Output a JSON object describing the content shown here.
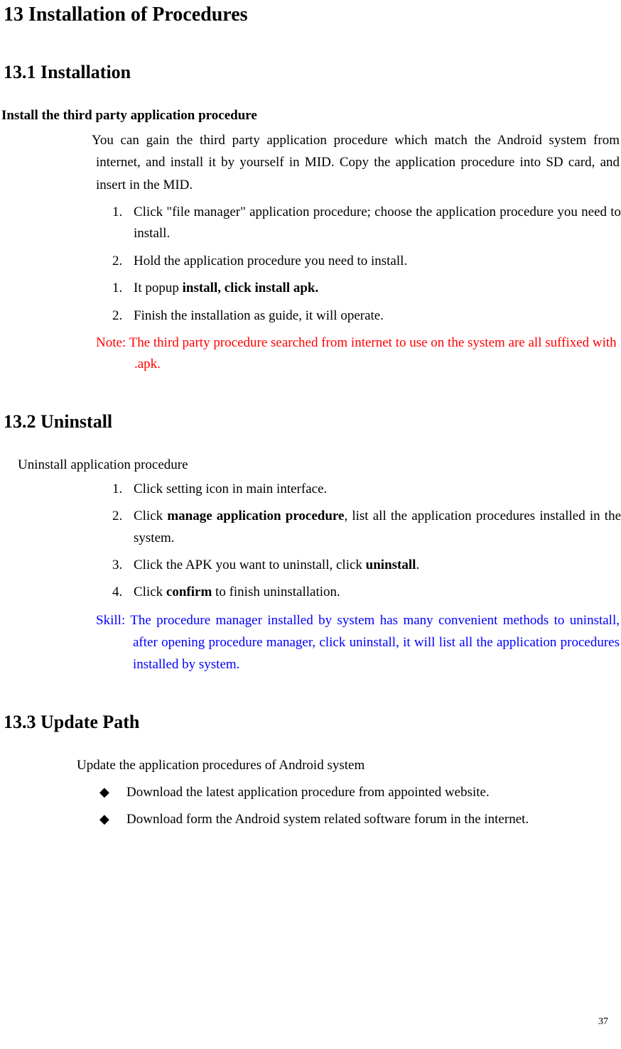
{
  "page_title": "13 Installation of Procedures",
  "page_number": "37",
  "section1": {
    "heading": "13.1 Installation",
    "subtitle": "Install the third party application procedure",
    "intro": "You can gain the third party application procedure which match the Android system from internet, and install it by yourself in MID. Copy the application procedure into SD card, and insert in the MID.",
    "steps": [
      {
        "n": "1.",
        "text_before": "Click \"file manager\" application procedure; choose the application procedure you need to install."
      },
      {
        "n": "2.",
        "text_before": "Hold the application procedure you need to install."
      },
      {
        "n": "1.",
        "text_before": "It popup ",
        "bold": "install, click install apk."
      },
      {
        "n": "2.",
        "text_before": "Finish the installation as guide, it will operate."
      }
    ],
    "note": "Note: The third party procedure searched from internet to use on the system are all suffixed with .apk."
  },
  "section2": {
    "heading": "13.2 Uninstall",
    "intro": "Uninstall application procedure",
    "steps": [
      {
        "n": "1.",
        "text_before": "Click setting icon in main interface."
      },
      {
        "n": "2.",
        "text_before": "Click ",
        "bold": "manage application procedure",
        "text_after": ", list all the application procedures installed in the system."
      },
      {
        "n": "3.",
        "text_before": "Click the APK you want to uninstall, click ",
        "bold": "uninstall",
        "text_after": "."
      },
      {
        "n": "4.",
        "text_before": "Click ",
        "bold": "confirm",
        "text_after": " to finish uninstallation."
      }
    ],
    "skill": "Skill: The procedure manager installed by system has many convenient methods to uninstall, after opening procedure manager, click uninstall, it will list all the application procedures installed by system."
  },
  "section3": {
    "heading": "13.3 Update Path",
    "intro": "Update the application procedures of Android system",
    "bullets": [
      "Download the latest application procedure from appointed website.",
      "Download form the Android system related software forum in the internet."
    ]
  }
}
